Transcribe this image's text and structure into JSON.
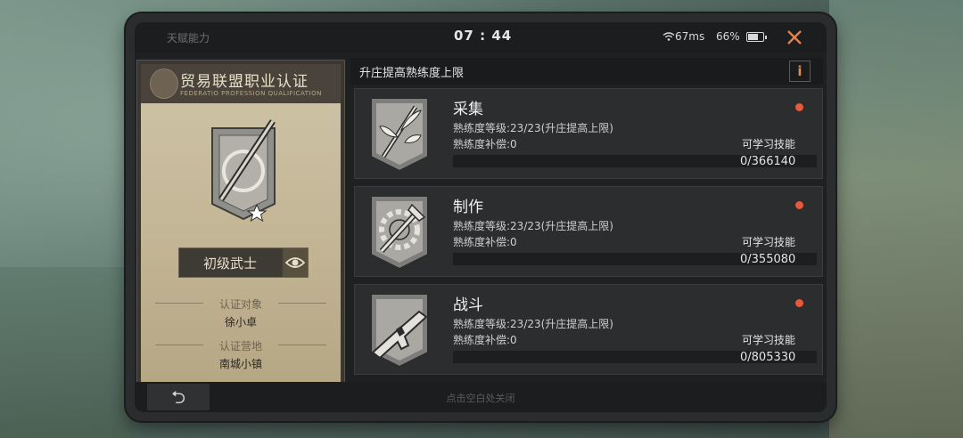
{
  "status": {
    "title": "天赋能力",
    "time": "07 : 44",
    "ping": "67ms",
    "battery": "66%"
  },
  "card": {
    "title": "贸易联盟职业认证",
    "subtitle": "FEDERATIO PROFESSION QUALIFICATION",
    "rank": "初级武士",
    "target_label": "认证对象",
    "target_value": "徐小卓",
    "base_label": "认证营地",
    "base_value": "南城小镇"
  },
  "panel": {
    "title": "升庄提高熟练度上限",
    "info": "i"
  },
  "skills": [
    {
      "name": "采集",
      "level": "熟练度等级:23/23(升庄提高上限)",
      "compensation": "熟练度补偿:0",
      "learn": "可学习技能",
      "progress": "0/366140",
      "icon": "gather-icon"
    },
    {
      "name": "制作",
      "level": "熟练度等级:23/23(升庄提高上限)",
      "compensation": "熟练度补偿:0",
      "learn": "可学习技能",
      "progress": "0/355080",
      "icon": "craft-icon"
    },
    {
      "name": "战斗",
      "level": "熟练度等级:23/23(升庄提高上限)",
      "compensation": "熟练度补偿:0",
      "learn": "可学习技能",
      "progress": "0/805330",
      "icon": "combat-icon"
    }
  ],
  "bottom": {
    "back": "⮌",
    "hint": "点击空白处关闭"
  },
  "colors": {
    "accent": "#e0814e",
    "dot": "#e8593a",
    "card": "#c2b594"
  }
}
